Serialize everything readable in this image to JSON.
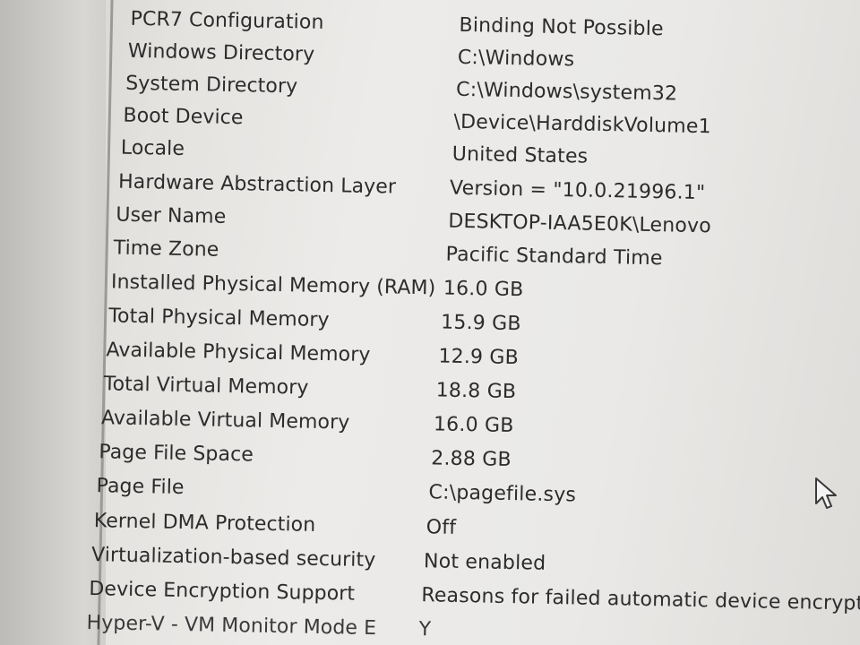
{
  "system_summary": {
    "rows": [
      {
        "item": "PCR7 Configuration",
        "value": "Binding Not Possible"
      },
      {
        "item": "Windows Directory",
        "value": "C:\\Windows"
      },
      {
        "item": "System Directory",
        "value": "C:\\Windows\\system32"
      },
      {
        "item": "Boot Device",
        "value": "\\Device\\HarddiskVolume1"
      },
      {
        "item": "Locale",
        "value": "United States"
      },
      {
        "item": "Hardware Abstraction Layer",
        "value": "Version = \"10.0.21996.1\""
      },
      {
        "item": "User Name",
        "value": "DESKTOP-IAA5E0K\\Lenovo"
      },
      {
        "item": "Time Zone",
        "value": "Pacific Standard Time"
      },
      {
        "item": "Installed Physical Memory (RAM)",
        "value": "16.0 GB"
      },
      {
        "item": "Total Physical Memory",
        "value": "15.9 GB"
      },
      {
        "item": "Available Physical Memory",
        "value": "12.9 GB"
      },
      {
        "item": "Total Virtual Memory",
        "value": "18.8 GB"
      },
      {
        "item": "Available Virtual Memory",
        "value": "16.0 GB"
      },
      {
        "item": "Page File Space",
        "value": "2.88 GB"
      },
      {
        "item": "Page File",
        "value": "C:\\pagefile.sys"
      },
      {
        "item": "Kernel DMA Protection",
        "value": "Off"
      },
      {
        "item": "Virtualization-based security",
        "value": "Not enabled"
      },
      {
        "item": "Device Encryption Support",
        "value": "Reasons for failed automatic device encrypti"
      },
      {
        "item": "Hyper-V - VM Monitor Mode E",
        "value": "Y"
      }
    ]
  },
  "icons": {
    "cursor": "mouse-pointer-icon"
  }
}
